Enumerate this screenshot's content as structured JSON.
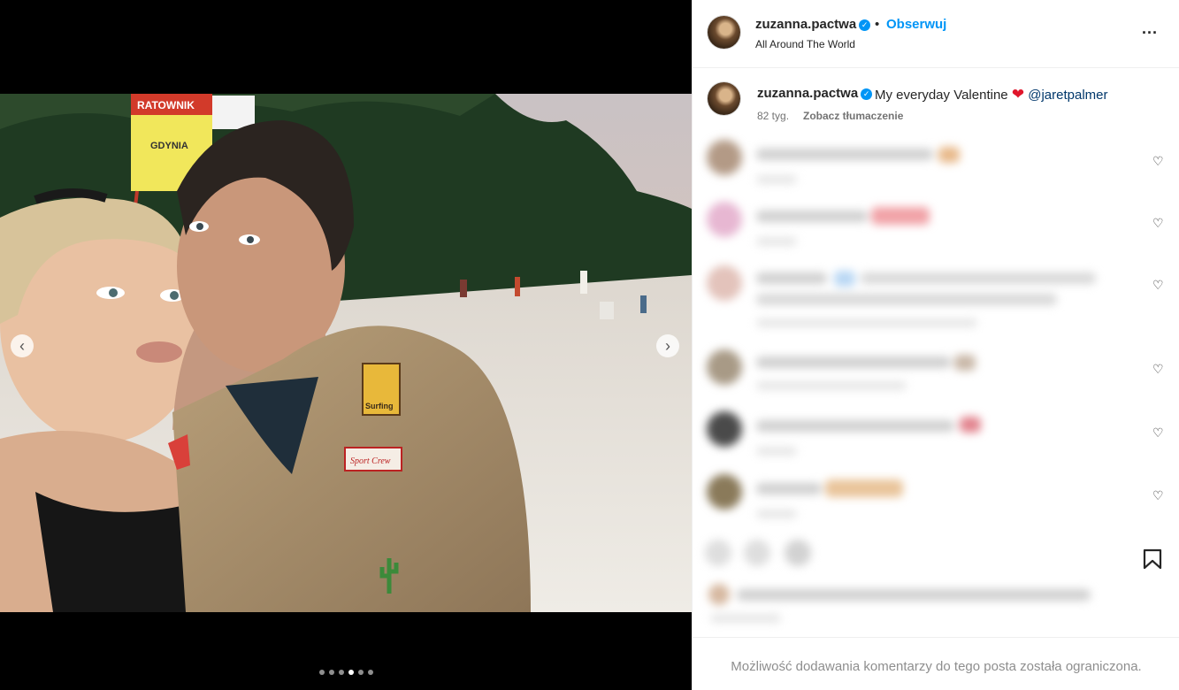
{
  "header": {
    "username": "zuzanna.pactwa",
    "separator": "•",
    "follow_label": "Obserwuj",
    "location": "All Around The World",
    "more_label": "..."
  },
  "caption": {
    "username": "zuzanna.pactwa",
    "text_before": "My everyday Valentine",
    "emoji": "❤",
    "mention": "@jaretpalmer",
    "time": "82 tyg.",
    "translate_label": "Zobacz tłumaczenie"
  },
  "carousel": {
    "total_slides": 6,
    "active_slide": 4,
    "prev_label": "‹",
    "next_label": "›"
  },
  "photo_text": {
    "sign_top": "RATOWNIK",
    "sign_bottom": "GDYNIA",
    "patch_1": "Surfing",
    "patch_2": "Sport Crew"
  },
  "comments_area": {
    "note": "",
    "like_icon": "♡"
  },
  "footer": {
    "restricted_text": "Możliwość dodawania komentarzy do tego posta została ograniczona."
  },
  "colors": {
    "accent": "#0095f6",
    "mention": "#00376b",
    "muted": "#737373",
    "heart": "#e0162b"
  }
}
